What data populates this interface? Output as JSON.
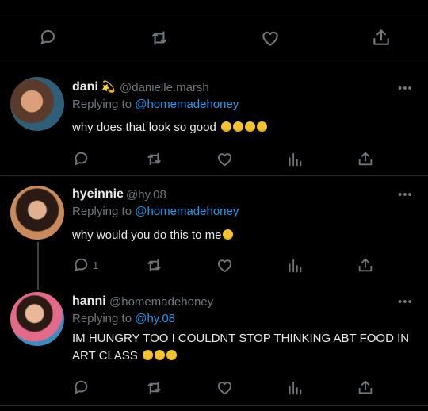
{
  "tweets": [
    {
      "name": "dani",
      "badge_emoji": "💫",
      "handle": "@danielle.marsh",
      "replying_prefix": "Replying to ",
      "replying_to": "@homemadehoney",
      "text": "why does that look so good",
      "emoji_count": 4,
      "reply_count": "",
      "avatar_colors": [
        "#7a5640",
        "#3c5a6e"
      ]
    },
    {
      "name": "hyeinnie",
      "handle": "@hy.08",
      "replying_prefix": "Replying to ",
      "replying_to": "@homemadehoney",
      "text": "why would you do this to me",
      "emoji_count": 1,
      "reply_count": "1",
      "avatar_colors": [
        "#c88a5a",
        "#2b1a14"
      ]
    },
    {
      "name": "hanni",
      "handle": "@homemadehoney",
      "replying_prefix": "Replying to ",
      "replying_to": "@hy.08",
      "text": "IM HUNGRY TOO I COULDNT STOP THINKING ABT FOOD IN ART CLASS",
      "emoji_count": 3,
      "reply_count": "",
      "avatar_colors": [
        "#e46a8a",
        "#3a8bbf"
      ]
    }
  ],
  "icons": {
    "reply": "speech-bubble-icon",
    "retweet": "retweet-icon",
    "like": "heart-icon",
    "analytics": "bar-chart-icon",
    "share": "share-upload-icon",
    "more": "ellipsis-icon"
  },
  "more_label": "•••",
  "colors": {
    "background": "#000000",
    "text": "#e7e9ea",
    "secondary": "#71767b",
    "link": "#1d9bf0",
    "divider": "#2a2d30"
  }
}
